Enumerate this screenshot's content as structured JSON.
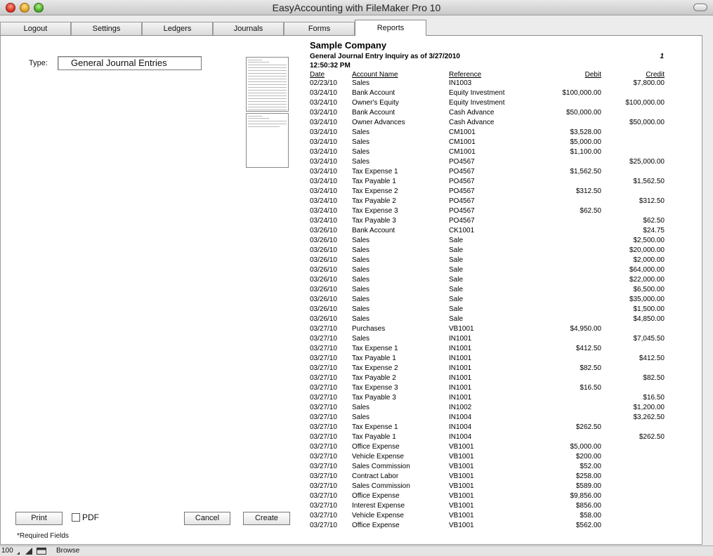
{
  "window": {
    "title": "EasyAccounting with FileMaker Pro 10"
  },
  "tabs": [
    {
      "label": "Logout"
    },
    {
      "label": "Settings"
    },
    {
      "label": "Ledgers"
    },
    {
      "label": "Journals"
    },
    {
      "label": "Forms"
    },
    {
      "label": "Reports",
      "active": true
    }
  ],
  "form": {
    "type_label": "Type:",
    "type_value": "General Journal Entries",
    "print_label": "Print",
    "pdf_label": "PDF",
    "pdf_checked": false,
    "cancel_label": "Cancel",
    "create_label": "Create",
    "required_note": "*Required Fields"
  },
  "report": {
    "company": "Sample Company",
    "subtitle": "General Journal Entry Inquiry as of 3/27/2010",
    "time": "12:50:32 PM",
    "page": "1",
    "headers": {
      "date": "Date",
      "account": "Account Name",
      "reference": "Reference",
      "debit": "Debit",
      "credit": "Credit"
    },
    "rows": [
      {
        "date": "02/23/10",
        "account": "Sales",
        "reference": "IN1003",
        "debit": "",
        "credit": "$7,800.00"
      },
      {
        "date": "03/24/10",
        "account": "Bank Account",
        "reference": "Equity Investment",
        "debit": "$100,000.00",
        "credit": ""
      },
      {
        "date": "03/24/10",
        "account": "Owner's Equity",
        "reference": "Equity Investment",
        "debit": "",
        "credit": "$100,000.00"
      },
      {
        "date": "03/24/10",
        "account": "Bank Account",
        "reference": "Cash Advance",
        "debit": "$50,000.00",
        "credit": ""
      },
      {
        "date": "03/24/10",
        "account": "Owner Advances",
        "reference": "Cash Advance",
        "debit": "",
        "credit": "$50,000.00"
      },
      {
        "date": "03/24/10",
        "account": "Sales",
        "reference": "CM1001",
        "debit": "$3,528.00",
        "credit": ""
      },
      {
        "date": "03/24/10",
        "account": "Sales",
        "reference": "CM1001",
        "debit": "$5,000.00",
        "credit": ""
      },
      {
        "date": "03/24/10",
        "account": "Sales",
        "reference": "CM1001",
        "debit": "$1,100.00",
        "credit": ""
      },
      {
        "date": "03/24/10",
        "account": "Sales",
        "reference": "PO4567",
        "debit": "",
        "credit": "$25,000.00"
      },
      {
        "date": "03/24/10",
        "account": "Tax Expense 1",
        "reference": "PO4567",
        "debit": "$1,562.50",
        "credit": ""
      },
      {
        "date": "03/24/10",
        "account": "Tax Payable 1",
        "reference": "PO4567",
        "debit": "",
        "credit": "$1,562.50"
      },
      {
        "date": "03/24/10",
        "account": "Tax Expense 2",
        "reference": "PO4567",
        "debit": "$312.50",
        "credit": ""
      },
      {
        "date": "03/24/10",
        "account": "Tax Payable 2",
        "reference": "PO4567",
        "debit": "",
        "credit": "$312.50"
      },
      {
        "date": "03/24/10",
        "account": "Tax Expense 3",
        "reference": "PO4567",
        "debit": "$62.50",
        "credit": ""
      },
      {
        "date": "03/24/10",
        "account": "Tax Payable 3",
        "reference": "PO4567",
        "debit": "",
        "credit": "$62.50"
      },
      {
        "date": "03/26/10",
        "account": "Bank Account",
        "reference": "CK1001",
        "debit": "",
        "credit": "$24.75"
      },
      {
        "date": "03/26/10",
        "account": "Sales",
        "reference": "Sale",
        "debit": "",
        "credit": "$2,500.00"
      },
      {
        "date": "03/26/10",
        "account": "Sales",
        "reference": "Sale",
        "debit": "",
        "credit": "$20,000.00"
      },
      {
        "date": "03/26/10",
        "account": "Sales",
        "reference": "Sale",
        "debit": "",
        "credit": "$2,000.00"
      },
      {
        "date": "03/26/10",
        "account": "Sales",
        "reference": "Sale",
        "debit": "",
        "credit": "$64,000.00"
      },
      {
        "date": "03/26/10",
        "account": "Sales",
        "reference": "Sale",
        "debit": "",
        "credit": "$22,000.00"
      },
      {
        "date": "03/26/10",
        "account": "Sales",
        "reference": "Sale",
        "debit": "",
        "credit": "$6,500.00"
      },
      {
        "date": "03/26/10",
        "account": "Sales",
        "reference": "Sale",
        "debit": "",
        "credit": "$35,000.00"
      },
      {
        "date": "03/26/10",
        "account": "Sales",
        "reference": "Sale",
        "debit": "",
        "credit": "$1,500.00"
      },
      {
        "date": "03/26/10",
        "account": "Sales",
        "reference": "Sale",
        "debit": "",
        "credit": "$4,850.00"
      },
      {
        "date": "03/27/10",
        "account": "Purchases",
        "reference": "VB1001",
        "debit": "$4,950.00",
        "credit": ""
      },
      {
        "date": "03/27/10",
        "account": "Sales",
        "reference": "IN1001",
        "debit": "",
        "credit": "$7,045.50"
      },
      {
        "date": "03/27/10",
        "account": "Tax Expense 1",
        "reference": "IN1001",
        "debit": "$412.50",
        "credit": ""
      },
      {
        "date": "03/27/10",
        "account": "Tax Payable 1",
        "reference": "IN1001",
        "debit": "",
        "credit": "$412.50"
      },
      {
        "date": "03/27/10",
        "account": "Tax Expense 2",
        "reference": "IN1001",
        "debit": "$82.50",
        "credit": ""
      },
      {
        "date": "03/27/10",
        "account": "Tax Payable 2",
        "reference": "IN1001",
        "debit": "",
        "credit": "$82.50"
      },
      {
        "date": "03/27/10",
        "account": "Tax Expense 3",
        "reference": "IN1001",
        "debit": "$16.50",
        "credit": ""
      },
      {
        "date": "03/27/10",
        "account": "Tax Payable 3",
        "reference": "IN1001",
        "debit": "",
        "credit": "$16.50"
      },
      {
        "date": "03/27/10",
        "account": "Sales",
        "reference": "IN1002",
        "debit": "",
        "credit": "$1,200.00"
      },
      {
        "date": "03/27/10",
        "account": "Sales",
        "reference": "IN1004",
        "debit": "",
        "credit": "$3,262.50"
      },
      {
        "date": "03/27/10",
        "account": "Tax Expense 1",
        "reference": "IN1004",
        "debit": "$262.50",
        "credit": ""
      },
      {
        "date": "03/27/10",
        "account": "Tax Payable 1",
        "reference": "IN1004",
        "debit": "",
        "credit": "$262.50"
      },
      {
        "date": "03/27/10",
        "account": "Office Expense",
        "reference": "VB1001",
        "debit": "$5,000.00",
        "credit": ""
      },
      {
        "date": "03/27/10",
        "account": "Vehicle Expense",
        "reference": "VB1001",
        "debit": "$200.00",
        "credit": ""
      },
      {
        "date": "03/27/10",
        "account": "Sales Commission",
        "reference": "VB1001",
        "debit": "$52.00",
        "credit": ""
      },
      {
        "date": "03/27/10",
        "account": "Contract Labor",
        "reference": "VB1001",
        "debit": "$258.00",
        "credit": ""
      },
      {
        "date": "03/27/10",
        "account": "Sales Commission",
        "reference": "VB1001",
        "debit": "$589.00",
        "credit": ""
      },
      {
        "date": "03/27/10",
        "account": "Office Expense",
        "reference": "VB1001",
        "debit": "$9,856.00",
        "credit": ""
      },
      {
        "date": "03/27/10",
        "account": "Interest Expense",
        "reference": "VB1001",
        "debit": "$856.00",
        "credit": ""
      },
      {
        "date": "03/27/10",
        "account": "Vehicle Expense",
        "reference": "VB1001",
        "debit": "$58.00",
        "credit": ""
      },
      {
        "date": "03/27/10",
        "account": "Office Expense",
        "reference": "VB1001",
        "debit": "$562.00",
        "credit": ""
      }
    ]
  },
  "statusbar": {
    "zoom": "100",
    "mode": "Browse"
  }
}
